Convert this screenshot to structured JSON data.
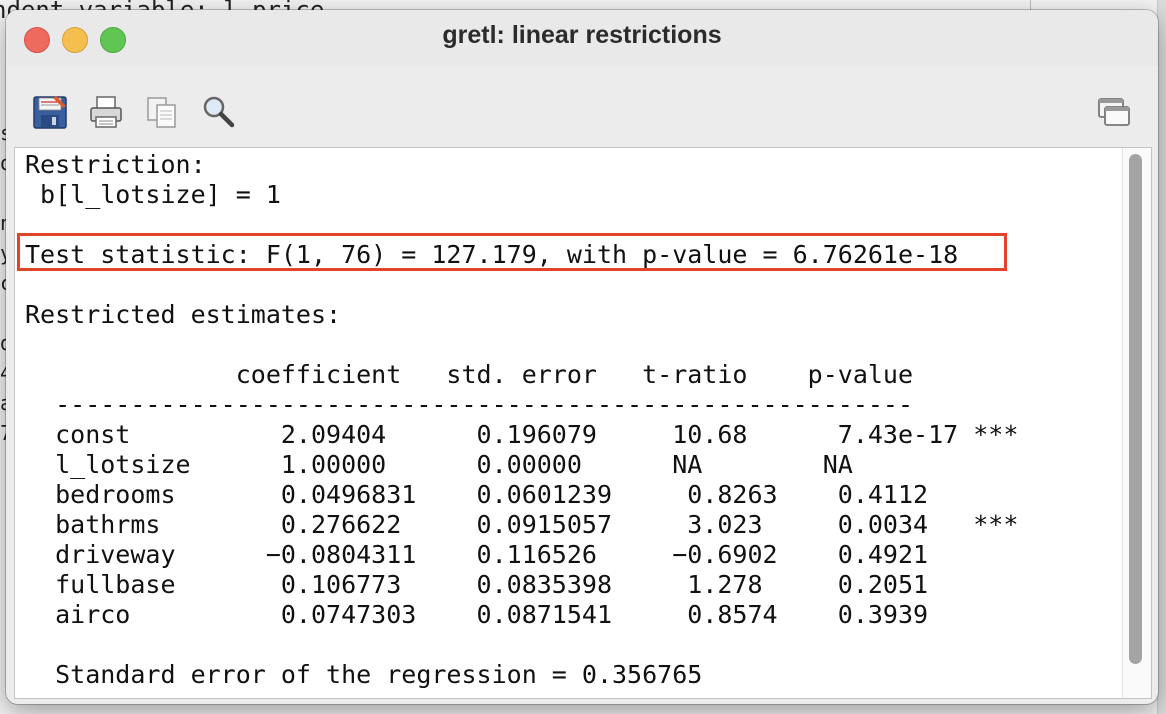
{
  "window": {
    "title": "gretl: linear restrictions"
  },
  "background": {
    "top_text": "ndent variable: l_price",
    "edge_chars": [
      "s",
      "o",
      "",
      "n",
      "y",
      "c",
      "",
      "d",
      "4",
      "a",
      "7"
    ]
  },
  "toolbar": {
    "icons": [
      "save-icon",
      "print-icon",
      "copy-icon",
      "find-icon",
      "window-icon"
    ]
  },
  "output": {
    "restriction_header": "Restriction:",
    "restriction": " b[l_lotsize] = 1",
    "test_statistic": "Test statistic: F(1, 76) = 127.179, with p-value = 6.76261e-18",
    "restricted_header": "Restricted estimates:",
    "table_header": "              coefficient   std. error   t-ratio    p-value",
    "table_rule": "  ---------------------------------------------------------",
    "rows": [
      {
        "line": "  const          2.09404      0.196079     10.68      7.43e-17 ***"
      },
      {
        "line": "  l_lotsize      1.00000      0.00000      NA        NA"
      },
      {
        "line": "  bedrooms       0.0496831    0.0601239     0.8263    0.4112"
      },
      {
        "line": "  bathrms        0.276622     0.0915057     3.023     0.0034   ***"
      },
      {
        "line": "  driveway      −0.0804311    0.116526     −0.6902    0.4921"
      },
      {
        "line": "  fullbase       0.106773     0.0835398     1.278     0.2051"
      },
      {
        "line": "  airco          0.0747303    0.0871541     0.8574    0.3939"
      }
    ],
    "std_error_line": "  Standard error of the regression = 0.356765"
  },
  "colors": {
    "highlight_border": "#e0452a",
    "close": "#ed6a5e",
    "minimize": "#f5bf4f",
    "maximize": "#61c554"
  }
}
